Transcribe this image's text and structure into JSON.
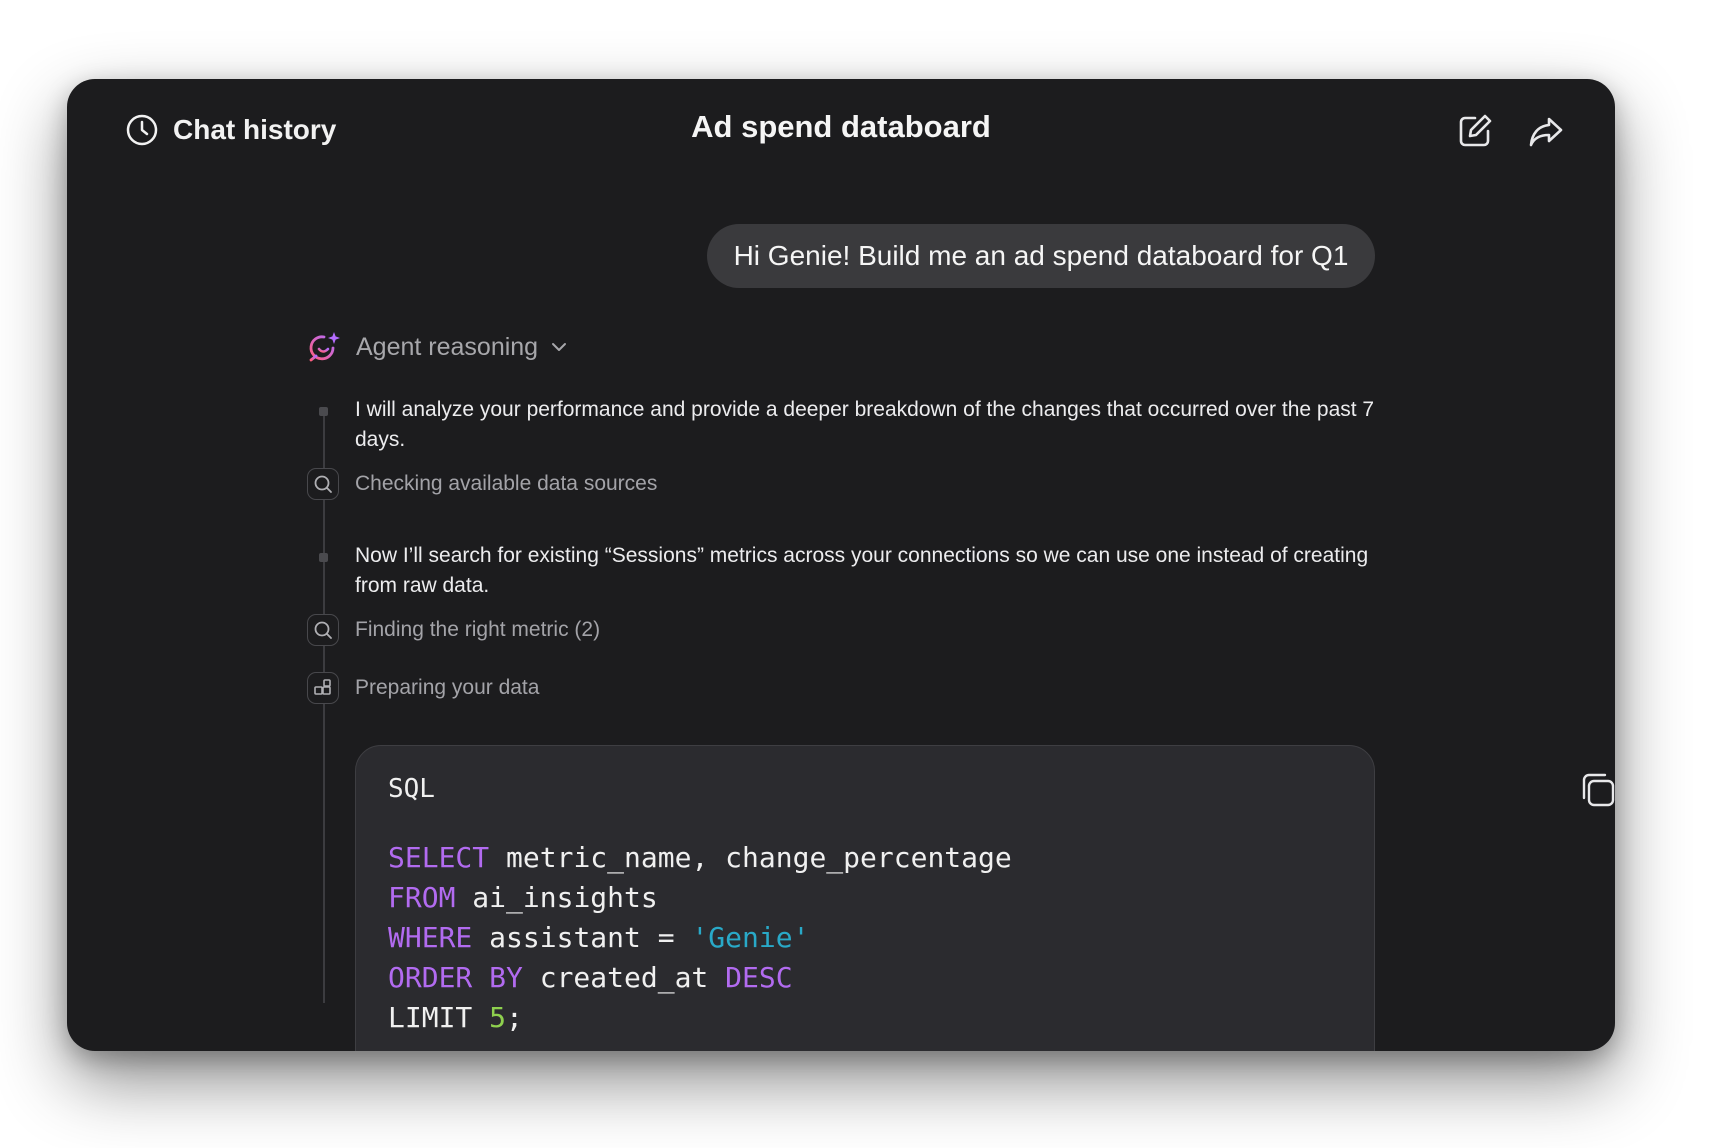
{
  "header": {
    "history_label": "Chat history",
    "title": "Ad spend databoard",
    "icons": {
      "history": "clock-icon",
      "edit": "edit-icon",
      "share": "share-icon"
    }
  },
  "chat": {
    "user_message": "Hi Genie! Build me an ad spend databoard for Q1"
  },
  "reasoning": {
    "label": "Agent reasoning",
    "icon": "agent-sparkle-icon",
    "steps": [
      {
        "type": "text",
        "text": "I will analyze your performance and provide a deeper breakdown of the changes that occurred over the past 7 days."
      },
      {
        "type": "action",
        "icon": "search-icon",
        "text": "Checking available data sources"
      },
      {
        "type": "text",
        "text": "Now I’ll search for existing “Sessions” metrics across your connections so we can use one instead of creating from raw data."
      },
      {
        "type": "action",
        "icon": "search-icon",
        "text": "Finding the right metric (2)"
      },
      {
        "type": "action",
        "icon": "data-prep-icon",
        "text": "Preparing your data"
      }
    ]
  },
  "code": {
    "language": "SQL",
    "tokens": {
      "l1_kw": "SELECT",
      "l1_rest": " metric_name, change_percentage",
      "l2_kw": "FROM",
      "l2_rest": " ai_insights",
      "l3_kw": "WHERE",
      "l3_rest": " assistant = ",
      "l3_str": "'Genie'",
      "l4_kw1": "ORDER BY",
      "l4_mid": " created_at ",
      "l4_kw2": "DESC",
      "l5_plain": "LIMIT ",
      "l5_num": "5",
      "l5_end": ";"
    },
    "copy_icon": "copy-icon"
  },
  "colors": {
    "background": "#1c1c1e",
    "keyword": "#b26bf0",
    "string": "#29a9c8",
    "number": "#8ed04e",
    "agent_gradient": [
      "#ff5e7e",
      "#b46cff"
    ]
  }
}
